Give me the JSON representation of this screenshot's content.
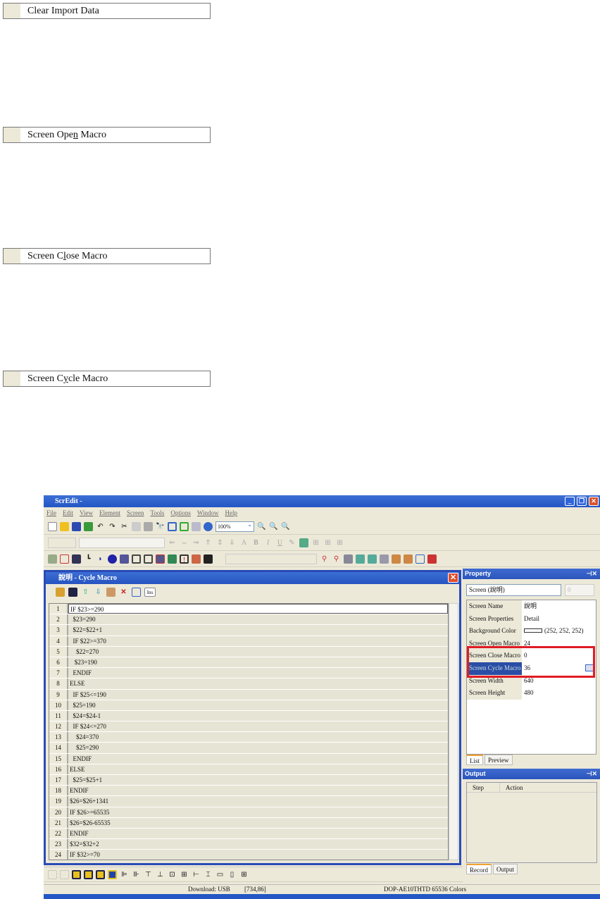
{
  "doc_menu": [
    {
      "pre": "Clear Import Data",
      "acc": "",
      "post": ""
    },
    {
      "pre": "Screen Ope",
      "acc": "n",
      "post": " Macro"
    },
    {
      "pre": "Screen C",
      "acc": "l",
      "post": "ose Macro"
    },
    {
      "pre": "Screen C",
      "acc": "y",
      "post": "cle Macro"
    }
  ],
  "app": {
    "title": "ScrEdit -",
    "menus": [
      "File",
      "Edit",
      "View",
      "Element",
      "Screen",
      "Tools",
      "Options",
      "Window",
      "Help"
    ],
    "zoom": "100%",
    "text_tools": [
      "B",
      "I",
      "U"
    ]
  },
  "macro": {
    "title": "說明 - Cycle Macro",
    "ins_label": "Ins",
    "lines": [
      "IF $23>=290",
      "  $23=290",
      "  $22=$22+1",
      "  IF $22>=370",
      "    $22=270",
      "   $23=190",
      "  ENDIF",
      "ELSE",
      "  IF $25<=190",
      "  $25=190",
      "  $24=$24-1",
      "  IF $24<=270",
      "    $24=370",
      "    $25=290",
      "  ENDIF",
      "ELSE",
      "  $25=$25+1",
      "ENDIF",
      "$26=$26+1341",
      "IF $26>=65535",
      "$26=$26-65535",
      "ENDIF",
      "$32=$32+2",
      "IF $32>=70"
    ],
    "selected_line": 1
  },
  "property": {
    "title": "Property",
    "selector": "Screen (說明)",
    "spin": "0",
    "rows": [
      {
        "k": "Screen Name",
        "v": "說明"
      },
      {
        "k": "Screen Properties",
        "v": "Detail"
      },
      {
        "k": "Background Color",
        "v": "(252, 252, 252)"
      },
      {
        "k": "Screen Open Macro",
        "v": "24"
      },
      {
        "k": "Screen Close Macro",
        "v": "0"
      },
      {
        "k": "Screen Cycle Macro",
        "v": "36"
      },
      {
        "k": "Screen Width",
        "v": "640"
      },
      {
        "k": "Screen Height",
        "v": "480"
      }
    ],
    "highlighted_row": "Screen Cycle Macro",
    "tabs": [
      "List",
      "Preview"
    ]
  },
  "output": {
    "title": "Output",
    "columns": [
      "Step",
      "Action"
    ],
    "tabs": [
      "Record",
      "Output"
    ]
  },
  "status": {
    "download": "Download: USB",
    "coords": "[734,86]",
    "model": "DOP-AE10THTD 65536 Colors"
  },
  "colors": {
    "highlight_box": "#e01b24",
    "title_bar": "#2456c4"
  }
}
